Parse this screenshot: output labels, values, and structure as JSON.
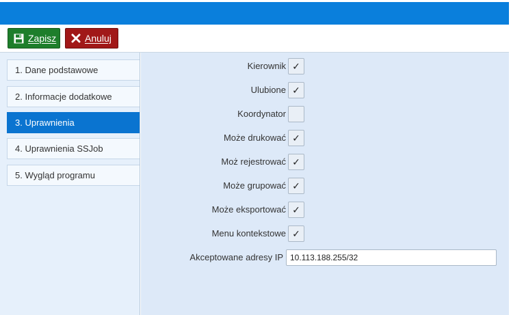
{
  "toolbar": {
    "save_label": "Zapisz",
    "cancel_label": "Anuluj",
    "save_color": "#1e7e2b",
    "cancel_color": "#a11818",
    "save_icon": "floppy-disk-icon",
    "cancel_icon": "close-x-icon"
  },
  "header": {
    "color": "#0a7fdc"
  },
  "sidebar": {
    "items": [
      {
        "label": "1. Dane podstawowe",
        "active": false
      },
      {
        "label": "2. Informacje dodatkowe",
        "active": false
      },
      {
        "label": "3. Uprawnienia",
        "active": true
      },
      {
        "label": "4. Uprawnienia SSJob",
        "active": false
      },
      {
        "label": "5. Wygląd programu",
        "active": false
      }
    ],
    "active_color": "#0a74d0"
  },
  "form": {
    "check_mark": "✓",
    "fields": [
      {
        "label": "Kierownik",
        "checked": true
      },
      {
        "label": "Ulubione",
        "checked": true
      },
      {
        "label": "Koordynator",
        "checked": false
      },
      {
        "label": "Może drukować",
        "checked": true
      },
      {
        "label": "Moż rejestrować",
        "checked": true
      },
      {
        "label": "Może grupować",
        "checked": true
      },
      {
        "label": "Może eksportować",
        "checked": true
      },
      {
        "label": "Menu kontekstowe",
        "checked": true
      }
    ],
    "ip": {
      "label": "Akceptowane adresy IP",
      "value": "10.113.188.255/32"
    }
  }
}
